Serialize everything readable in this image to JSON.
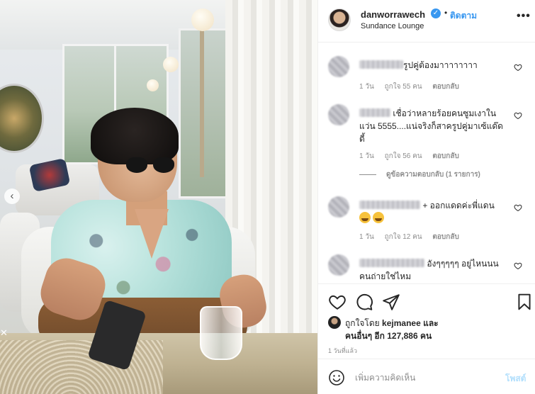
{
  "post": {
    "username": "danworrawech",
    "follow_label": "ติดตาม",
    "location": "Sundance Lounge",
    "more_glyph": "•••",
    "verified_glyph": "✓",
    "separator": "•"
  },
  "comments": [
    {
      "text": "รูปคู่ต้องมาาาาาาาา",
      "time": "1 วัน",
      "likes": "ถูกใจ 55 คน",
      "reply_label": "ตอบกลับ"
    },
    {
      "text": "เชื่อว่าหลายร้อยคนซูมเงาในแว่น 5555....แน่จริงก็สาครูปคู่มาเซ้แด๊ดดี้",
      "time": "1 วัน",
      "likes": "ถูกใจ 56 คน",
      "reply_label": "ตอบกลับ",
      "view_replies": "ดูข้อความตอบกลับ (1 รายการ)"
    },
    {
      "text": "+ ออกแดดค่ะพี่แดน",
      "time": "1 วัน",
      "likes": "ถูกใจ 12 คน",
      "reply_label": "ตอบกลับ"
    },
    {
      "text": "อังๆๆๆๆๆ อยู่ไหนนนคนถ่ายใช่ไหม"
    }
  ],
  "likes": {
    "line1_prefix": "ถูกใจโดย",
    "line1_user": "kejmanee",
    "line1_suffix": "และ",
    "line2_prefix": "คนอื่นๆ อีก",
    "line2_count": "127,886",
    "line2_suffix": "คน"
  },
  "time_ago": "1 วันที่แล้ว",
  "add_comment": {
    "placeholder": "เพิ่มความคิดเห็น",
    "post_label": "โพสต์"
  },
  "photo": {
    "nav_glyph": "‹",
    "close_glyph": "✕"
  },
  "colors": {
    "link_blue": "#3897f0",
    "post_disabled": "#b2dffc",
    "muted": "#8e8e8e",
    "text": "#262626"
  },
  "icons": [
    "heart-icon",
    "comment-icon",
    "share-icon",
    "bookmark-icon",
    "smile-icon",
    "verified-badge-icon"
  ]
}
